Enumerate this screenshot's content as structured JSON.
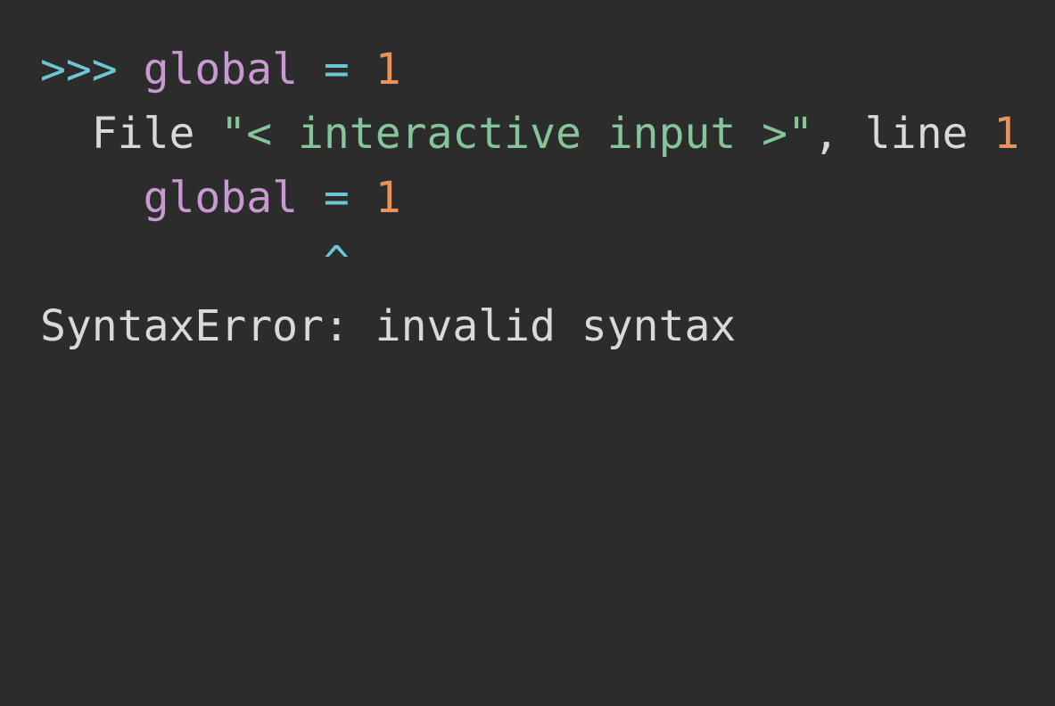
{
  "colors": {
    "background": "#2c2c2c",
    "prompt": "#6cc7d3",
    "keyword": "#c79ad0",
    "operator": "#6cc7d3",
    "number": "#e6935e",
    "string": "#86c49a",
    "text": "#d9d9d9"
  },
  "line1": {
    "prompt": ">>>",
    "keyword": "global",
    "operator": "=",
    "number": "1"
  },
  "line2": {
    "file_word": "File",
    "file_string": "\"< interactive input >\"",
    "comma": ",",
    "line_word": "line",
    "line_number": "1"
  },
  "line3": {
    "keyword": "global",
    "operator": "=",
    "number": "1"
  },
  "line4": {
    "caret": "^"
  },
  "line5": {
    "error_text": "SyntaxError: invalid syntax"
  }
}
